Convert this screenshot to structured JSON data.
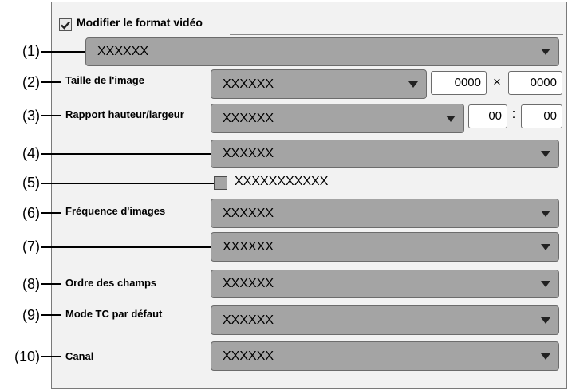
{
  "header": {
    "checkbox_checked": true,
    "title": "Modifier le format vidéo"
  },
  "callouts": [
    "(1)",
    "(2)",
    "(3)",
    "(4)",
    "(5)",
    "(6)",
    "(7)",
    "(8)",
    "(9)",
    "(10)"
  ],
  "rows": {
    "format_combo": {
      "value": "XXXXXX"
    },
    "frame_size": {
      "label": "Taille de l'image",
      "value": "XXXXXX",
      "width": "0000",
      "separator": "×",
      "height": "0000"
    },
    "aspect_ratio": {
      "label": "Rapport hauteur/largeur",
      "value": "XXXXXX",
      "num": "00",
      "separator": ":",
      "den": "00"
    },
    "row4": {
      "value": "XXXXXX"
    },
    "row5_checkbox": {
      "label": "XXXXXXXXXXX",
      "checked": false
    },
    "frame_rate": {
      "label": "Fréquence d'images",
      "value": "XXXXXX"
    },
    "row7": {
      "value": "XXXXXX"
    },
    "field_order": {
      "label": "Ordre des champs",
      "value": "XXXXXX"
    },
    "tc_mode": {
      "label": "Mode TC par défaut",
      "value": "XXXXXX"
    },
    "channel": {
      "label": "Canal",
      "value": "XXXXXX"
    }
  },
  "icons": {
    "header_checkbox": "checkmark-icon",
    "dropdown": "triangle-down-icon"
  },
  "colors": {
    "combo_bg": "#a4a4a4",
    "panel_bg": "#f2f2f2"
  }
}
